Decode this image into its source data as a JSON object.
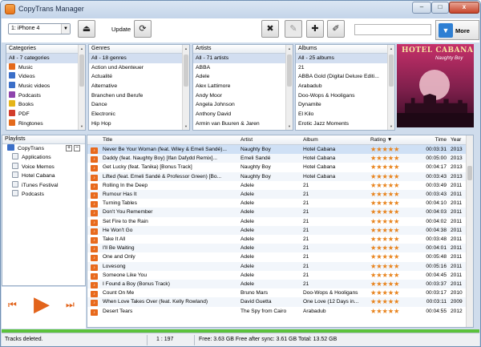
{
  "window": {
    "title": "CopyTrans Manager",
    "minimize_label": "–",
    "maximize_label": "□",
    "close_label": "x"
  },
  "toolbar": {
    "device": "1: iPhone 4",
    "update_label": "Update",
    "more_label": "More",
    "eject_glyph": "⏏",
    "more_glyph": "▼"
  },
  "icons": {
    "update": "refresh-icon",
    "delete": "delete-track-icon",
    "edit": "edit-tags-icon",
    "add": "add-track-icon",
    "notes": "notes-icon"
  },
  "categories": {
    "header": "Categories",
    "items": [
      {
        "label": "All - 7 categories",
        "color": ""
      },
      {
        "label": "Music",
        "color": "#e46a1c"
      },
      {
        "label": "Videos",
        "color": "#3b6fc8"
      },
      {
        "label": "Music videos",
        "color": "#3b6fc8"
      },
      {
        "label": "Podcasts",
        "color": "#8e44ad"
      },
      {
        "label": "Books",
        "color": "#e5b51a"
      },
      {
        "label": "PDF",
        "color": "#d23c2b"
      },
      {
        "label": "Ringtones",
        "color": "#e46a1c"
      }
    ]
  },
  "genres": {
    "header": "Genres",
    "items": [
      "All - 18 genres",
      "Action und Abenteuer",
      "Actualité",
      "Alternative",
      "Branchen und Berufe",
      "Dance",
      "Electronic",
      "Hip Hop"
    ]
  },
  "artists": {
    "header": "Artists",
    "items": [
      "All - 71 artists",
      "ABBA",
      "Adele",
      "Alex Lattimore",
      "Andy Moor",
      "Angela Johnson",
      "Anthony David",
      "Armin van Buuren & Jaren"
    ]
  },
  "albums": {
    "header": "Albums",
    "items": [
      "All - 25 albums",
      "21",
      "ABBA Gold (Digital Deluxe Editi...",
      "Arabadub",
      "Doo-Wops & Hooligans",
      "Dynamite",
      "El Kilo",
      "Erotic Jazz Moments"
    ]
  },
  "artwork": {
    "title": "HOTEL CABANA",
    "subtitle": "Naughty Boy"
  },
  "playlists": {
    "header": "Playlists",
    "root": "CopyTrans",
    "items": [
      "Applications",
      "Voice Memos",
      "Hotel Cabana",
      "iTunes Festival",
      "Podcasts"
    ]
  },
  "player": {
    "prev": "⏮",
    "play": "▶",
    "next": "⏭"
  },
  "track_table": {
    "columns": {
      "title": "Title",
      "artist": "Artist",
      "album": "Album",
      "rating": "Rating",
      "time": "Time",
      "year": "Year"
    },
    "rows": [
      {
        "title": "Never Be Your Woman (feat. Wiley & Emeli Sandé)...",
        "artist": "Naughty Boy",
        "album": "Hotel Cabana",
        "rating": 5,
        "time": "00:03:31",
        "year": "2013"
      },
      {
        "title": "Daddy (feat. Naughty Boy) [Ifan Dafydd Remix]...",
        "artist": "Emeli Sandé",
        "album": "Hotel Cabana",
        "rating": 5,
        "time": "00:05:00",
        "year": "2013"
      },
      {
        "title": "Get Lucky (feat. Tanika) [Bonus Track]",
        "artist": "Naughty Boy",
        "album": "Hotel Cabana",
        "rating": 5,
        "time": "00:04:17",
        "year": "2013"
      },
      {
        "title": "Lifted (feat. Emeli Sandé & Professor Green) [Bo...",
        "artist": "Naughty Boy",
        "album": "Hotel Cabana",
        "rating": 5,
        "time": "00:03:43",
        "year": "2013"
      },
      {
        "title": "Rolling In the Deep",
        "artist": "Adele",
        "album": "21",
        "rating": 5,
        "time": "00:03:49",
        "year": "2011"
      },
      {
        "title": "Rumour Has It",
        "artist": "Adele",
        "album": "21",
        "rating": 5,
        "time": "00:03:43",
        "year": "2011"
      },
      {
        "title": "Turning Tables",
        "artist": "Adele",
        "album": "21",
        "rating": 5,
        "time": "00:04:10",
        "year": "2011"
      },
      {
        "title": "Don't You Remember",
        "artist": "Adele",
        "album": "21",
        "rating": 5,
        "time": "00:04:03",
        "year": "2011"
      },
      {
        "title": "Set Fire to the Rain",
        "artist": "Adele",
        "album": "21",
        "rating": 5,
        "time": "00:04:02",
        "year": "2011"
      },
      {
        "title": "He Won't Go",
        "artist": "Adele",
        "album": "21",
        "rating": 5,
        "time": "00:04:38",
        "year": "2011"
      },
      {
        "title": "Take It All",
        "artist": "Adele",
        "album": "21",
        "rating": 5,
        "time": "00:03:48",
        "year": "2011"
      },
      {
        "title": "I'll Be Waiting",
        "artist": "Adele",
        "album": "21",
        "rating": 5,
        "time": "00:04:01",
        "year": "2011"
      },
      {
        "title": "One and Only",
        "artist": "Adele",
        "album": "21",
        "rating": 5,
        "time": "00:05:48",
        "year": "2011"
      },
      {
        "title": "Lovesong",
        "artist": "Adele",
        "album": "21",
        "rating": 5,
        "time": "00:05:16",
        "year": "2011"
      },
      {
        "title": "Someone Like You",
        "artist": "Adele",
        "album": "21",
        "rating": 5,
        "time": "00:04:45",
        "year": "2011"
      },
      {
        "title": "I Found a Boy (Bonus Track)",
        "artist": "Adele",
        "album": "21",
        "rating": 5,
        "time": "00:03:37",
        "year": "2011"
      },
      {
        "title": "Count On Me",
        "artist": "Bruno Mars",
        "album": "Doo-Wops & Hooligans",
        "rating": 5,
        "time": "00:03:17",
        "year": "2010"
      },
      {
        "title": "When Love Takes Over (feat. Kelly Rowland)",
        "artist": "David Guetta",
        "album": "One Love (12 Days in...",
        "rating": 5,
        "time": "00:03:11",
        "year": "2009"
      },
      {
        "title": "Desert Tears",
        "artist": "The Spy from Cairo",
        "album": "Arabadub",
        "rating": 5,
        "time": "00:04:55",
        "year": "2012"
      }
    ]
  },
  "status": {
    "message": "Tracks deleted.",
    "position": "1 : 197",
    "storage": "Free: 3.63 GB  Free after sync: 3.61 GB  Total: 13.52 GB"
  },
  "colors": {
    "accent": "#e8691c",
    "progress": "#5bc23b",
    "selection": "#d2def0"
  }
}
